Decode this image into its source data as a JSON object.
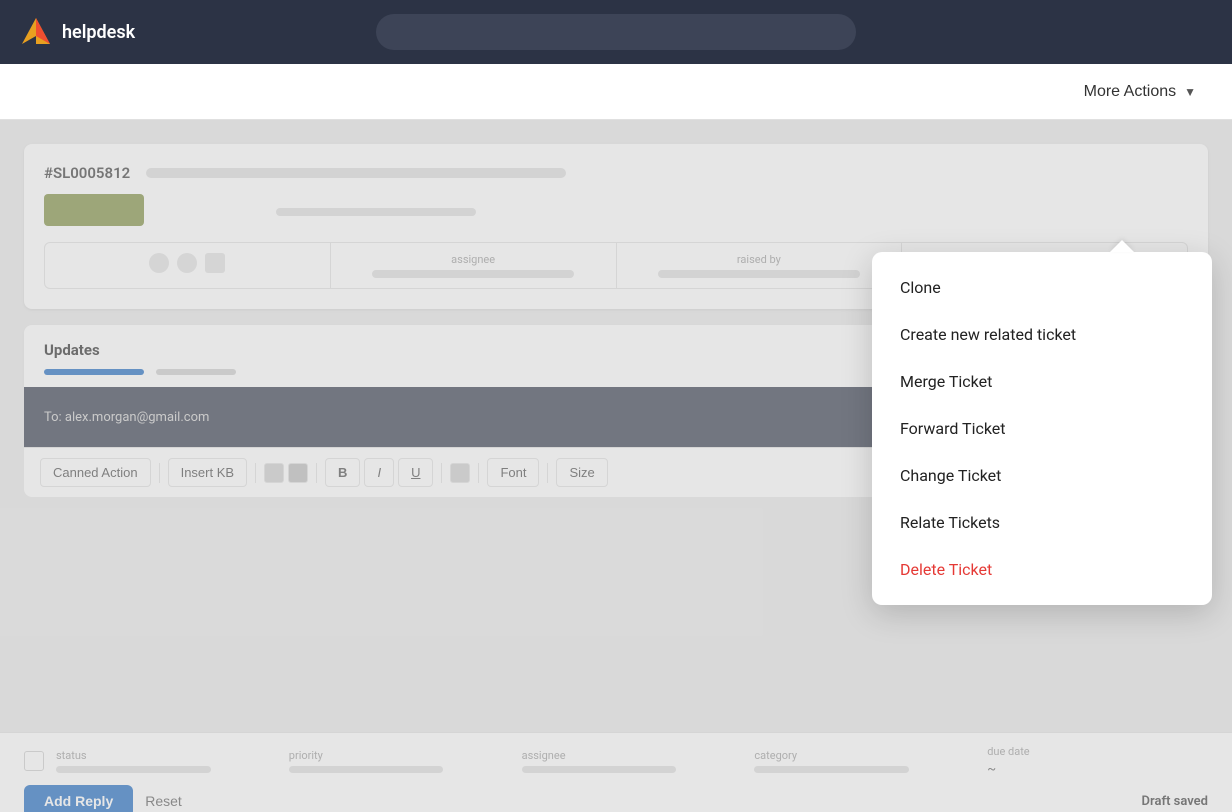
{
  "navbar": {
    "logo_text": "helpdesk",
    "search_placeholder": ""
  },
  "header": {
    "more_actions_label": "More Actions"
  },
  "ticket": {
    "id": "#SL0005812",
    "status_label": "",
    "assignee_label": "assignee",
    "raised_by_label": "raised by"
  },
  "updates": {
    "title": "Updates"
  },
  "reply": {
    "to": "To: alex.morgan@gmail.com",
    "minimize": "—"
  },
  "toolbar": {
    "canned_action": "Canned Action",
    "insert_kb": "Insert KB",
    "bold": "B",
    "italic": "I",
    "underline": "U",
    "font": "Font",
    "size": "Size"
  },
  "bottom": {
    "status_label": "status",
    "priority_label": "priority",
    "assignee_label": "assignee",
    "category_label": "category",
    "due_date_label": "due date",
    "due_date_value": "~",
    "add_reply_label": "Add Reply",
    "reset_label": "Reset",
    "draft_saved": "Draft saved"
  },
  "dropdown": {
    "items": [
      {
        "label": "Clone",
        "danger": false
      },
      {
        "label": "Create new related ticket",
        "danger": false
      },
      {
        "label": "Merge Ticket",
        "danger": false
      },
      {
        "label": "Forward Ticket",
        "danger": false
      },
      {
        "label": "Change Ticket",
        "danger": false
      },
      {
        "label": "Relate Tickets",
        "danger": false
      },
      {
        "label": "Delete Ticket",
        "danger": true
      }
    ]
  },
  "colors": {
    "brand": "#1565c0",
    "navbar_bg": "#2c3345",
    "danger": "#e53935",
    "ticket_status_bg": "#7a8a3a"
  }
}
